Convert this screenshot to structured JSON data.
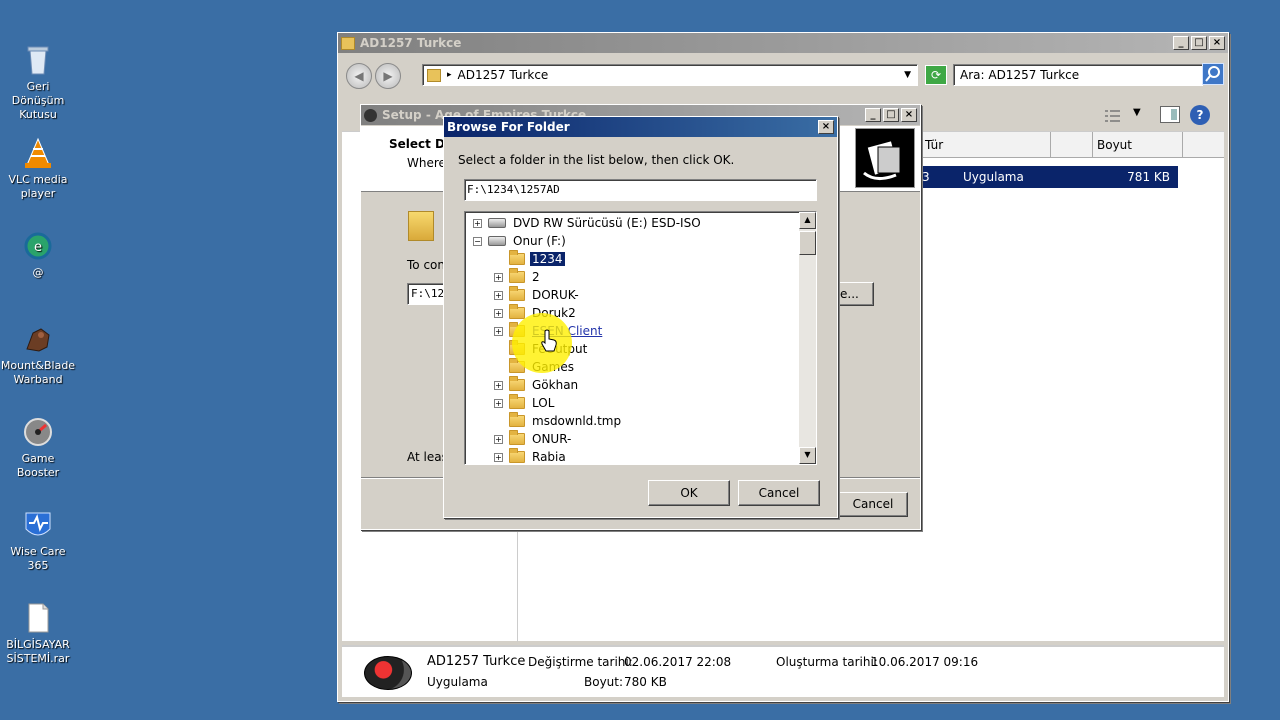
{
  "desktop": {
    "icons": [
      {
        "label": "Geri Dönüşüm Kutusu",
        "icon": "recycle-bin-icon"
      },
      {
        "label": "VLC media player",
        "icon": "vlc-icon"
      },
      {
        "label": "@",
        "icon": "app-icon"
      },
      {
        "label": "Mount&Blade Warband",
        "icon": "mount-blade-icon"
      },
      {
        "label": "Game Booster",
        "icon": "game-booster-icon"
      },
      {
        "label": "Wise Care 365",
        "icon": "wise-care-icon"
      },
      {
        "label": "BİLGİSAYAR SİSTEMİ.rar",
        "icon": "rar-file-icon"
      }
    ]
  },
  "explorer": {
    "title": "AD1257 Turkce",
    "address": "AD1257 Turkce",
    "search_placeholder": "Ara: AD1257 Turkce",
    "columns": {
      "type": "Tür",
      "size": "Boyut"
    },
    "row": {
      "prefix": "3",
      "type": "Uygulama",
      "size": "781 KB"
    },
    "details": {
      "name": "AD1257 Turkce",
      "modified_label": "Değiştirme tarihi:",
      "modified": "02.06.2017 22:08",
      "created_label": "Oluşturma tarihi:",
      "created": "10.06.2017 09:16",
      "kind": "Uygulama",
      "size_label": "Boyut:",
      "size": "780 KB"
    }
  },
  "setup": {
    "title": "Setup - Age of Empires Turkce",
    "heading": "Select D",
    "subheading": "Where",
    "continue_text": "To con",
    "path_value": "F:\\12",
    "browse_label": "e...",
    "atleast_text": "At leas",
    "cancel_label": "Cancel"
  },
  "browse": {
    "title": "Browse For Folder",
    "instruction": "Select a folder in the list below, then click OK.",
    "path": "F:\\1234\\1257AD",
    "ok_label": "OK",
    "cancel_label": "Cancel",
    "tree": [
      {
        "label": "DVD RW Sürücüsü (E:) ESD-ISO",
        "level": 0,
        "expander": "+",
        "kind": "drive"
      },
      {
        "label": "Onur (F:)",
        "level": 0,
        "expander": "−",
        "kind": "drive"
      },
      {
        "label": "1234",
        "level": 1,
        "expander": "",
        "kind": "folder",
        "selected": true
      },
      {
        "label": "2",
        "level": 1,
        "expander": "+",
        "kind": "folder"
      },
      {
        "label": "DORUK-",
        "level": 1,
        "expander": "+",
        "kind": "folder"
      },
      {
        "label": "Doruk2",
        "level": 1,
        "expander": "+",
        "kind": "folder"
      },
      {
        "label": "ESEN Client",
        "level": 1,
        "expander": "+",
        "kind": "folder",
        "hover": true
      },
      {
        "label": "FeOutput",
        "level": 1,
        "expander": "",
        "kind": "folder"
      },
      {
        "label": "Games",
        "level": 1,
        "expander": "",
        "kind": "folder"
      },
      {
        "label": "Gökhan",
        "level": 1,
        "expander": "+",
        "kind": "folder"
      },
      {
        "label": "LOL",
        "level": 1,
        "expander": "+",
        "kind": "folder"
      },
      {
        "label": "msdownld.tmp",
        "level": 1,
        "expander": "",
        "kind": "folder"
      },
      {
        "label": "ONUR-",
        "level": 1,
        "expander": "+",
        "kind": "folder"
      },
      {
        "label": "Rabia",
        "level": 1,
        "expander": "+",
        "kind": "folder"
      }
    ]
  }
}
